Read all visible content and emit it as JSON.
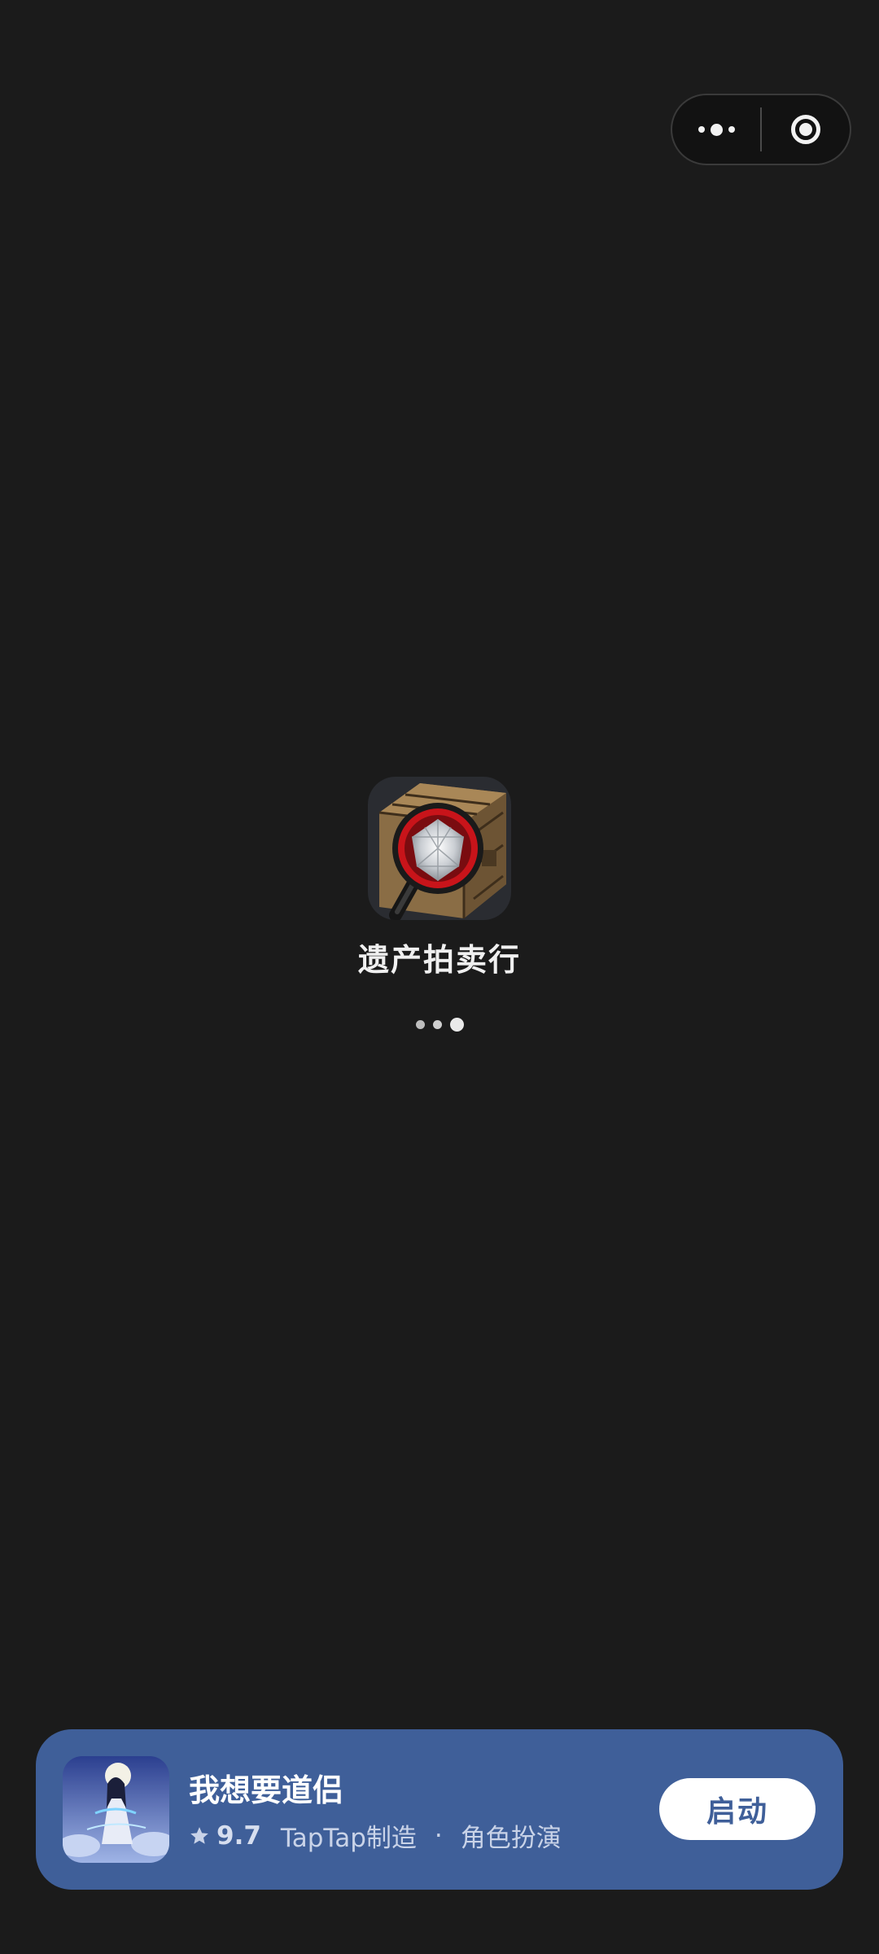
{
  "capsule": {
    "more_icon": "more-dots-icon",
    "close_icon": "target-close-icon"
  },
  "loading_screen": {
    "app_name": "遗产拍卖行",
    "app_icon": "treasure-chest-magnifier-icon"
  },
  "ad_banner": {
    "game_title": "我想要道侣",
    "rating": "9.7",
    "maker": "TapTap制造",
    "separator": "·",
    "genre": "角色扮演",
    "launch_label": "启动",
    "background_color": "#3f5f99"
  }
}
